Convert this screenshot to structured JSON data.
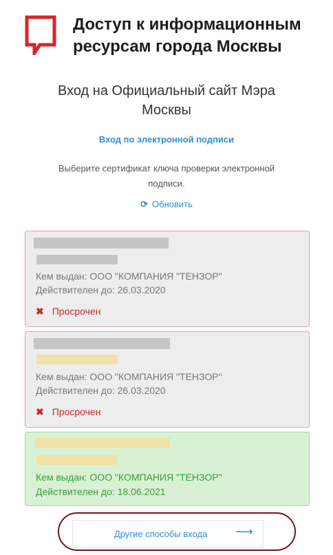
{
  "header": {
    "brand_line1": "Доступ к информационным",
    "brand_line2": "ресурсам города Москвы",
    "logo_icon": "speech-bubble-logo-icon",
    "accent_color": "#d8262d"
  },
  "page_title_line1": "Вход на Официальный сайт Мэра",
  "page_title_line2": "Москвы",
  "es_login_link": "Вход по электронной подписи",
  "hint_line1": "Выберите сертификат ключа проверки электронной",
  "hint_line2": "подписи.",
  "refresh": {
    "icon": "refresh-icon",
    "label": "Обновить"
  },
  "certificates": [
    {
      "issued_by": "Кем выдан: ООО \"КОМПАНИЯ \"ТЕНЗОР\"",
      "valid_until": "Действителен до: 26.03.2020",
      "status_icon": "close-icon",
      "status": "Просрочен"
    },
    {
      "issued_by": "Кем выдан: ООО \"КОМПАНИЯ \"ТЕНЗОР\"",
      "valid_until": "Действителен до: 26.03.2020",
      "status_icon": "close-icon",
      "status": "Просрочен"
    },
    {
      "issued_by": "Кем выдан: ООО \"КОМПАНИЯ \"ТЕНЗОР\"",
      "valid_until": "Действителен до: 18.06.2021"
    }
  ],
  "other_methods": {
    "label": "Другие способы входа",
    "icon": "arrow-right-icon"
  },
  "colors": {
    "link": "#2d8fd6",
    "expired_border": "#e2a3a3",
    "expired_text": "#c62a2a",
    "valid_bg": "#d8f1d4",
    "valid_text": "#3a9a3a",
    "highlight_outline": "#7a0f19"
  }
}
